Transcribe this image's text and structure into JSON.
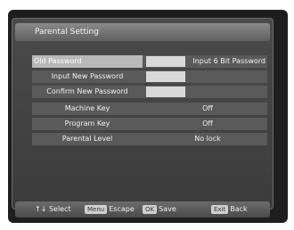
{
  "title": "Parental Setting",
  "rows": [
    {
      "label": "Old Password",
      "value": "",
      "hint": "Input 6 Bit Password"
    },
    {
      "label": "Input New Password",
      "value": ""
    },
    {
      "label": "Confirm New Password",
      "value": ""
    },
    {
      "label": "Machine Key",
      "value": "Off"
    },
    {
      "label": "Program Key",
      "value": "Off"
    },
    {
      "label": "Parental Level",
      "value": "No lock"
    }
  ],
  "footer": {
    "select_label": "Select",
    "menu_key": "Menu",
    "escape_label": "Escape",
    "ok_key": "OK",
    "save_label": "Save",
    "exit_key": "Exit",
    "back_label": "Back"
  }
}
